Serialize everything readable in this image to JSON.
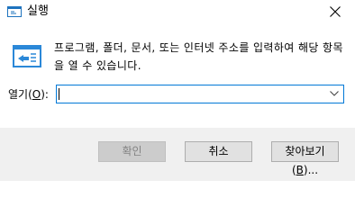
{
  "window": {
    "title": "실행"
  },
  "description": "프로그램, 폴더, 문서, 또는 인터넷 주소를 입력하여 해당 항목을 열 수 있습니다.",
  "open_field": {
    "label_prefix": "열기(",
    "label_access_key": "O",
    "label_suffix": "):",
    "value": "",
    "dropdown_icon": "chevron-down-icon"
  },
  "buttons": {
    "ok": "확인",
    "cancel": "취소",
    "browse_prefix": "찾아보기(",
    "browse_access_key": "B",
    "browse_suffix": ")..."
  },
  "colors": {
    "focus_border": "#0078d7",
    "footer_background": "#f0f0f0",
    "button_background": "#e1e1e1",
    "disabled_button_text": "#838383"
  }
}
